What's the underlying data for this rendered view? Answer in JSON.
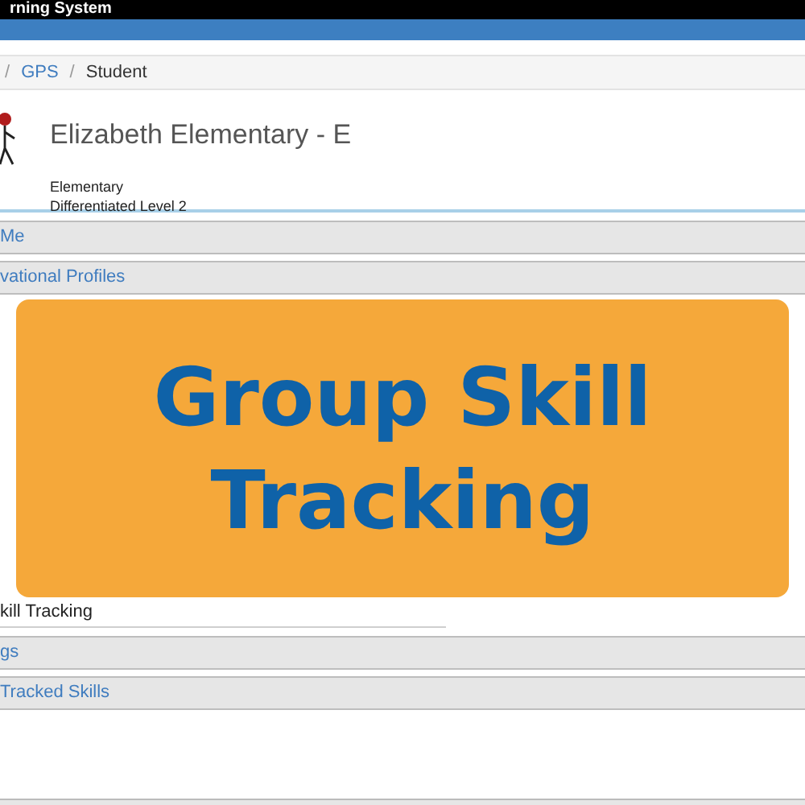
{
  "app_title": "rning System",
  "breadcrumb": [
    {
      "separator": "/",
      "label": "GPS",
      "link": true
    },
    {
      "separator": "/",
      "label": "Student",
      "link": false
    }
  ],
  "student": {
    "name": "Elizabeth Elementary - E",
    "lines": [
      "Elementary",
      "Differentiated Level 2"
    ]
  },
  "sections_top": [
    "Me",
    "vational Profiles"
  ],
  "skill_tracking_label": "kill Tracking",
  "sections_bottom": [
    "gs",
    "Tracked Skills"
  ],
  "overlay": {
    "title_lines": [
      "Group Skill",
      "Tracking"
    ]
  }
}
